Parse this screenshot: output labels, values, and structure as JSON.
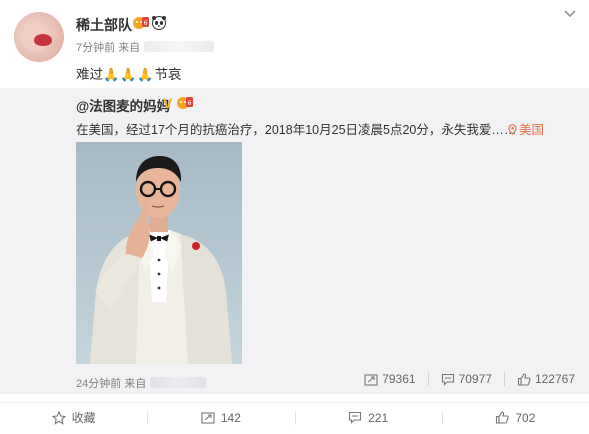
{
  "post": {
    "username": "稀土部队",
    "time": "7分钟前",
    "source_prefix": "来自",
    "text_before": "难过",
    "pray_emoji": "🙏🙏🙏",
    "text_after": "节哀"
  },
  "repost": {
    "author": "@法图麦的妈妈",
    "verified_mark": "V",
    "text": "在美国，经过17个月的抗癌治疗，2018年10月25日凌晨5点20分，永失我爱……",
    "location": "美国",
    "time": "24分钟前",
    "source_prefix": "来自",
    "stats": {
      "reposts": "79361",
      "comments": "70977",
      "likes": "122767"
    }
  },
  "toolbar": {
    "favorite": "收藏",
    "repost": "142",
    "comment": "221",
    "like": "702"
  },
  "colors": {
    "repost_bg": "#f2f2f5",
    "location": "#eb7350",
    "verified": "#f3b020",
    "meta_text": "#808080"
  }
}
